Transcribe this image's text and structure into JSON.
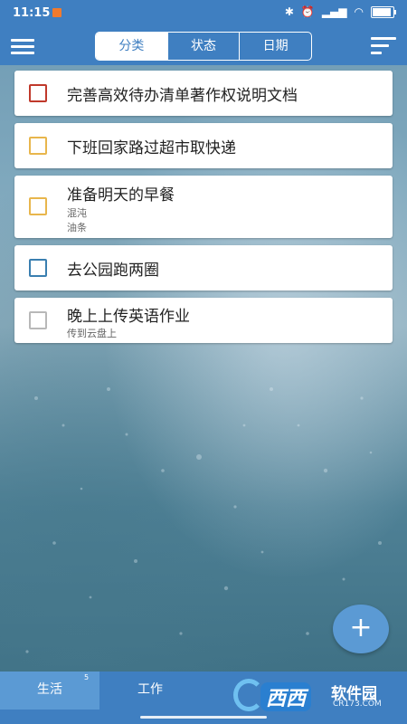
{
  "status_bar": {
    "time": "11:15",
    "icons": [
      "bluetooth-icon",
      "alarm-icon",
      "signal-icon",
      "wifi-icon"
    ],
    "battery_percent": 85
  },
  "toolbar": {
    "tabs": [
      {
        "label": "分类",
        "active": true
      },
      {
        "label": "状态",
        "active": false
      },
      {
        "label": "日期",
        "active": false
      }
    ]
  },
  "tasks": [
    {
      "title": "完善高效待办清单著作权说明文档",
      "subtitles": [],
      "color": "#c0392b"
    },
    {
      "title": "下班回家路过超市取快递",
      "subtitles": [],
      "color": "#e8b64c"
    },
    {
      "title": "准备明天的早餐",
      "subtitles": [
        "混沌",
        "油条"
      ],
      "color": "#e8b64c"
    },
    {
      "title": "去公园跑两圈",
      "subtitles": [],
      "color": "#3a7fb0"
    },
    {
      "title": "晚上上传英语作业",
      "subtitles": [
        "传到云盘上"
      ],
      "color": "#b8b8b8"
    }
  ],
  "fab": {
    "label": "+"
  },
  "bottom_tabs": [
    {
      "label": "生活",
      "badge": "5",
      "active": true
    },
    {
      "label": "工作",
      "badge": "",
      "active": false
    }
  ],
  "watermark": {
    "brand": "西西",
    "site": "软件园",
    "url": "CR173.COM"
  },
  "colors": {
    "primary": "#3f7fc1",
    "accent": "#5b9ad4"
  }
}
